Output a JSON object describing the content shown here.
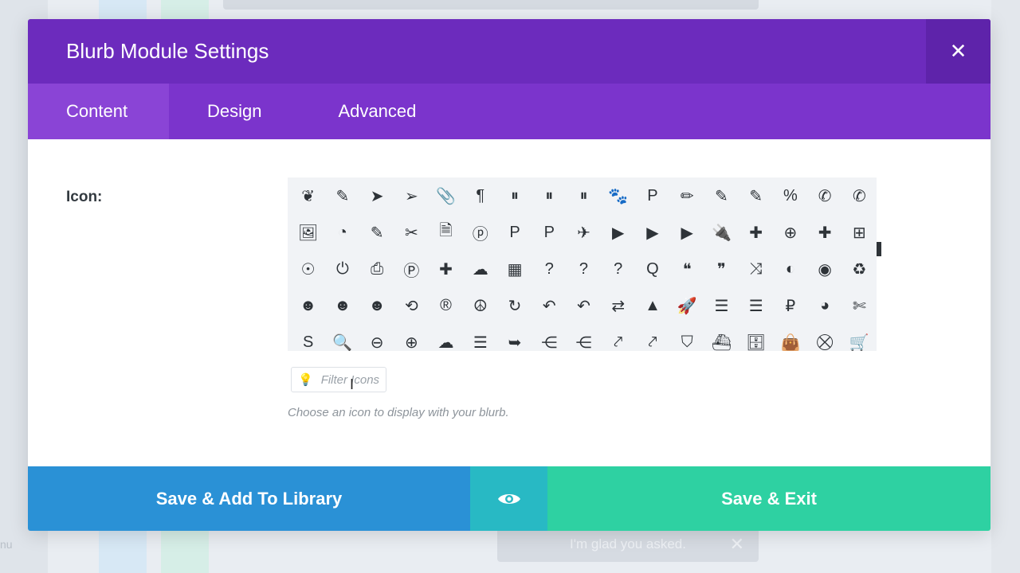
{
  "background": {
    "hint_text": "I'm glad you asked.",
    "side_text": "nu"
  },
  "modal": {
    "title": "Blurb Module Settings",
    "close_glyph": "✕",
    "tabs": [
      {
        "label": "Content",
        "active": true
      },
      {
        "label": "Design",
        "active": false
      },
      {
        "label": "Advanced",
        "active": false
      }
    ],
    "icon_field": {
      "label": "Icon:",
      "filter_placeholder": "Filter Icons",
      "help_text": "Choose an icon to display with your blurb.",
      "icons": [
        [
          "❦",
          "✎",
          "➤",
          "➢",
          "📎",
          "¶",
          "⏸",
          "⏸",
          "⏸",
          "🐾",
          "P",
          "✏",
          "✎",
          "✎",
          "%",
          "✆",
          "✆"
        ],
        [
          "🖼",
          "◔",
          "✎",
          "✂",
          "🗎",
          "ⓟ",
          "P",
          "P",
          "✈",
          "▶",
          "▶",
          "▶",
          "🔌",
          "✚",
          "⊕",
          "✚",
          "⊞"
        ],
        [
          "☉",
          "⏻",
          "⎙",
          "Ⓟ",
          "✚",
          "☁",
          "▦",
          "?",
          "?",
          "?",
          "Q",
          "❝",
          "❞",
          "⤨",
          "◐",
          "◉",
          "♻"
        ],
        [
          "☻",
          "☻",
          "☻",
          "⟲",
          "®",
          "☮",
          "↻",
          "↶",
          "↶",
          "⇄",
          "▲",
          "🚀",
          "☰",
          "☰",
          "₽",
          "◕",
          "✄"
        ],
        [
          "S",
          "🔍",
          "⊖",
          "⊕",
          "☁",
          "☰",
          "➥",
          "⋲",
          "⋲",
          "⤤",
          "⤤",
          "⛉",
          "⛴",
          "🗄",
          "👜",
          "⛒",
          "🛒"
        ]
      ]
    },
    "footer": {
      "library_label": "Save & Add To Library",
      "preview_icon": "eye-icon",
      "exit_label": "Save & Exit"
    }
  },
  "colors": {
    "header": "#6c2bbd",
    "tabs": "#7b34cc",
    "library_button": "#2a91d6",
    "preview_button": "#28b9c4",
    "exit_button": "#2ed1a2"
  }
}
